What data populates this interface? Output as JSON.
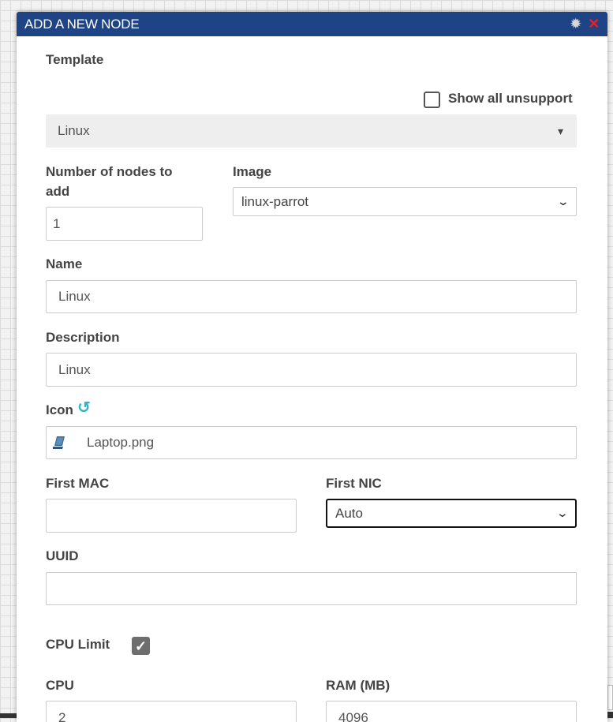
{
  "dialog": {
    "title": "ADD A NEW NODE",
    "gear_glyph": "✹",
    "close_glyph": "✕"
  },
  "template": {
    "label": "Template",
    "show_unsupported_label": "Show all unsupport",
    "show_unsupported_checked": false,
    "value": "Linux",
    "caret": "▾"
  },
  "nodes_count": {
    "label": "Number of nodes to add",
    "value": "1"
  },
  "image": {
    "label": "Image",
    "value": "linux-parrot",
    "chevron": "⌄"
  },
  "name": {
    "label": "Name",
    "value": "Linux"
  },
  "description": {
    "label": "Description",
    "value": "Linux"
  },
  "icon": {
    "label": "Icon",
    "refresh_glyph": "↺",
    "value": "Laptop.png",
    "icon_name": "laptop-icon"
  },
  "first_mac": {
    "label": "First MAC",
    "value": ""
  },
  "first_nic": {
    "label": "First NIC",
    "value": "Auto",
    "chevron": "⌄"
  },
  "uuid": {
    "label": "UUID",
    "value": ""
  },
  "cpu_limit": {
    "label": "CPU Limit",
    "checked": true,
    "check_glyph": "✓"
  },
  "cpu": {
    "label": "CPU",
    "value": "2"
  },
  "ram": {
    "label": "RAM (MB)",
    "value": "4096"
  },
  "colors": {
    "titlebar": "#1e4486",
    "close": "#e0242b",
    "refresh": "#2bb8c9",
    "checked_box": "#6e6e6e"
  }
}
